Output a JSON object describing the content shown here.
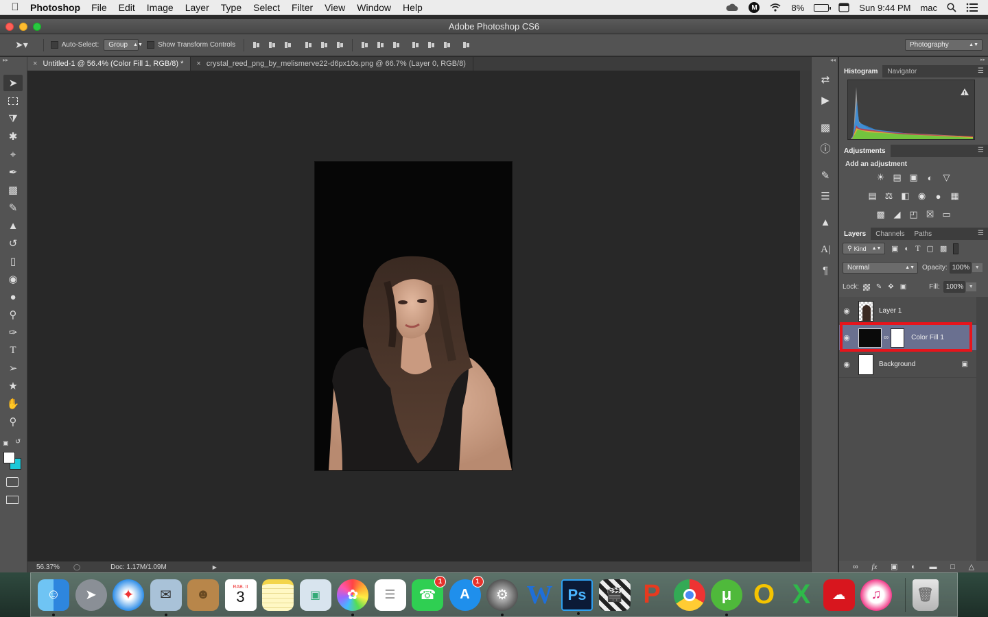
{
  "menubar": {
    "app_name": "Photoshop",
    "items": [
      "File",
      "Edit",
      "Image",
      "Layer",
      "Type",
      "Select",
      "Filter",
      "View",
      "Window",
      "Help"
    ],
    "battery": "8%",
    "clock": "Sun 9:44 PM",
    "user": "mac"
  },
  "window": {
    "title": "Adobe Photoshop CS6"
  },
  "options": {
    "auto_select_label": "Auto-Select:",
    "auto_select_value": "Group",
    "transform_label": "Show Transform Controls",
    "workspace": "Photography"
  },
  "tabs": [
    {
      "label": "Untitled-1 @ 56.4% (Color Fill 1, RGB/8) *",
      "active": true
    },
    {
      "label": "crystal_reed_png_by_melismerve22-d6px10s.png @ 66.7% (Layer 0, RGB/8)",
      "active": false
    }
  ],
  "status": {
    "zoom": "56.37%",
    "doc": "Doc: 1.17M/1.09M"
  },
  "panels": {
    "histogram_tab": "Histogram",
    "navigator_tab": "Navigator",
    "adjustments_tab": "Adjustments",
    "add_adjustment": "Add an adjustment",
    "layers_tab": "Layers",
    "channels_tab": "Channels",
    "paths_tab": "Paths",
    "kind_label": "Kind",
    "blend_mode": "Normal",
    "opacity_label": "Opacity:",
    "opacity_value": "100%",
    "lock_label": "Lock:",
    "fill_label": "Fill:",
    "fill_value": "100%"
  },
  "layers": [
    {
      "name": "Layer 1"
    },
    {
      "name": "Color Fill 1"
    },
    {
      "name": "Background"
    }
  ],
  "colors": {
    "foreground": "#ffffff",
    "background": "#1ec8d8",
    "highlight": "#e8141b",
    "selected_layer": "#6a7090"
  },
  "dock": {
    "calendar_month": "RAB. II",
    "calendar_day": "3",
    "facetime_badge": "1",
    "appstore_badge": "1",
    "ps_label": "Ps",
    "word_label": "W",
    "excel_label": "X"
  }
}
